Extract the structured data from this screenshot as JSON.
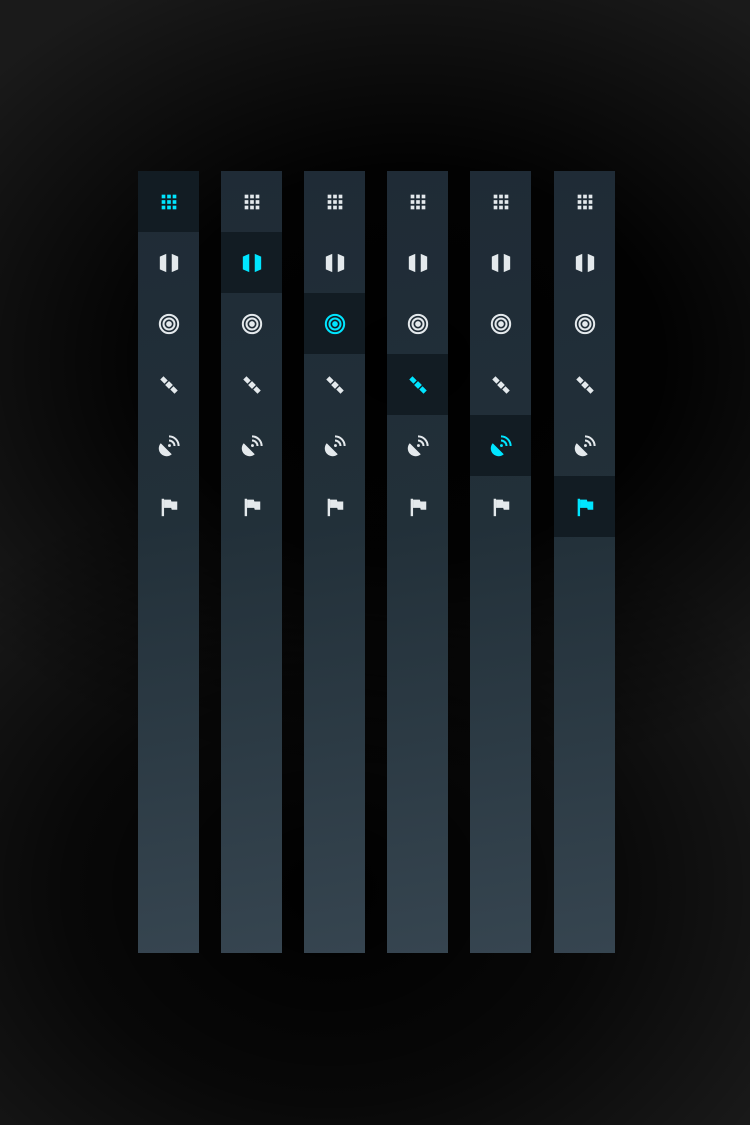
{
  "colors": {
    "rail_background": "#223039",
    "active_item_background": "#121c23",
    "icon_default": "#e4e9ec",
    "icon_active": "#00e5ff",
    "page_background": "#1a1a1a"
  },
  "nav_items": [
    {
      "id": "apps",
      "icon": "apps-grid-icon"
    },
    {
      "id": "map",
      "icon": "map-icon"
    },
    {
      "id": "target",
      "icon": "target-icon"
    },
    {
      "id": "satellite",
      "icon": "satellite-icon"
    },
    {
      "id": "satellite-dish",
      "icon": "satellite-dish-icon"
    },
    {
      "id": "flag",
      "icon": "flag-icon"
    }
  ],
  "rails": [
    {
      "active_item": "apps"
    },
    {
      "active_item": "map"
    },
    {
      "active_item": "target"
    },
    {
      "active_item": "satellite"
    },
    {
      "active_item": "satellite-dish"
    },
    {
      "active_item": "flag"
    }
  ]
}
